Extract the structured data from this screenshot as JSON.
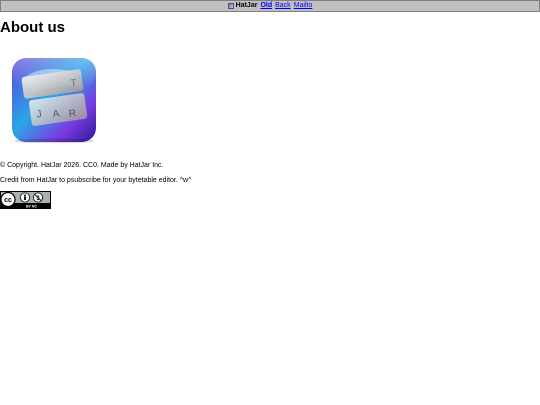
{
  "nav": {
    "brand": "HatJar",
    "links": [
      "Old",
      "Back",
      "Mailto"
    ]
  },
  "page": {
    "title": "About us",
    "copyright": "© Copyright. HatJar 2026. CC0. Made by HatJar Inc.",
    "credit": "Credit from HatJar to psubscribe for your bytetable editor. ^w^"
  },
  "logo": {
    "letters": [
      "T",
      "J",
      "A",
      "R"
    ]
  },
  "license": {
    "badge_text": "BY  NC",
    "icon": "creative-commons-by-nc-icon"
  },
  "colors": {
    "topbar_bg": "#c0c0c0",
    "link": "#0000ee"
  }
}
